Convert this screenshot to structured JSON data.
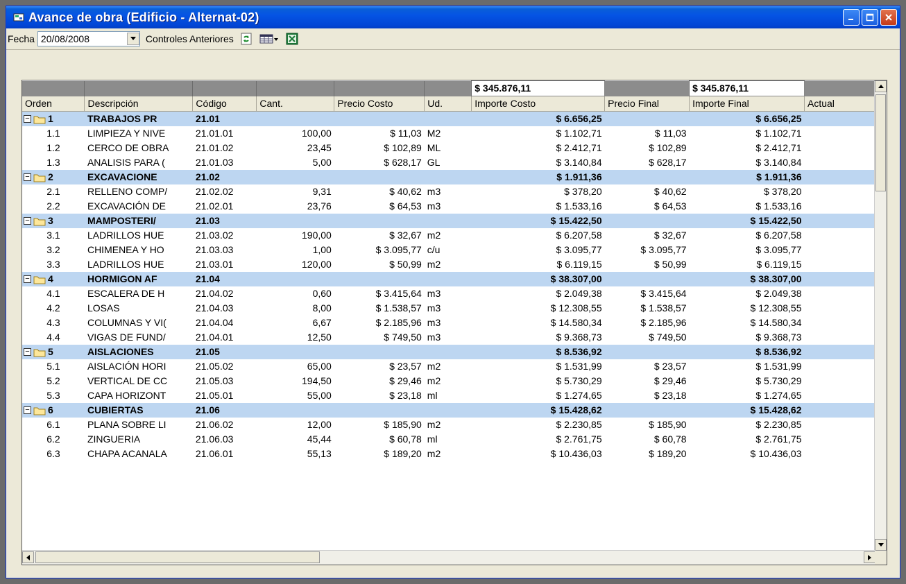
{
  "window": {
    "title": "Avance de obra (Edificio - Alternat-02)"
  },
  "toolbar": {
    "fecha_label": "Fecha",
    "fecha_value": "20/08/2008",
    "controles_label": "Controles Anteriores"
  },
  "totals": {
    "importe_costo": "$ 345.876,11",
    "importe_final": "$ 345.876,11"
  },
  "columns": [
    "Orden",
    "Descripción",
    "Código",
    "Cant.",
    "Precio Costo",
    "Ud.",
    "Importe Costo",
    "Precio Final",
    "Importe Final",
    "Actual"
  ],
  "rows": [
    {
      "type": "group",
      "orden": "1",
      "desc": "TRABAJOS PR",
      "codigo": "21.01",
      "importe_costo": "$ 6.656,25",
      "importe_final": "$ 6.656,25"
    },
    {
      "type": "item",
      "orden": "1.1",
      "desc": "LIMPIEZA Y NIVE",
      "codigo": "21.01.01",
      "cant": "100,00",
      "precio_costo": "$ 11,03",
      "ud": "M2",
      "importe_costo": "$ 1.102,71",
      "precio_final": "$ 11,03",
      "importe_final": "$ 1.102,71"
    },
    {
      "type": "item",
      "orden": "1.2",
      "desc": "CERCO DE OBRA",
      "codigo": "21.01.02",
      "cant": "23,45",
      "precio_costo": "$ 102,89",
      "ud": "ML",
      "importe_costo": "$ 2.412,71",
      "precio_final": "$ 102,89",
      "importe_final": "$ 2.412,71"
    },
    {
      "type": "item",
      "orden": "1.3",
      "desc": "ANALISIS PARA (",
      "codigo": "21.01.03",
      "cant": "5,00",
      "precio_costo": "$ 628,17",
      "ud": "GL",
      "importe_costo": "$ 3.140,84",
      "precio_final": "$ 628,17",
      "importe_final": "$ 3.140,84"
    },
    {
      "type": "group",
      "orden": "2",
      "desc": "EXCAVACIONE",
      "codigo": "21.02",
      "importe_costo": "$ 1.911,36",
      "importe_final": "$ 1.911,36"
    },
    {
      "type": "item",
      "orden": "2.1",
      "desc": "RELLENO COMP/",
      "codigo": "21.02.02",
      "cant": "9,31",
      "precio_costo": "$ 40,62",
      "ud": "m3",
      "importe_costo": "$ 378,20",
      "precio_final": "$ 40,62",
      "importe_final": "$ 378,20"
    },
    {
      "type": "item",
      "orden": "2.2",
      "desc": "EXCAVACIÓN DE",
      "codigo": "21.02.01",
      "cant": "23,76",
      "precio_costo": "$ 64,53",
      "ud": "m3",
      "importe_costo": "$ 1.533,16",
      "precio_final": "$ 64,53",
      "importe_final": "$ 1.533,16"
    },
    {
      "type": "group",
      "orden": "3",
      "desc": "MAMPOSTERI/",
      "codigo": "21.03",
      "importe_costo": "$ 15.422,50",
      "importe_final": "$ 15.422,50"
    },
    {
      "type": "item",
      "orden": "3.1",
      "desc": "LADRILLOS HUE",
      "codigo": "21.03.02",
      "cant": "190,00",
      "precio_costo": "$ 32,67",
      "ud": "m2",
      "importe_costo": "$ 6.207,58",
      "precio_final": "$ 32,67",
      "importe_final": "$ 6.207,58"
    },
    {
      "type": "item",
      "orden": "3.2",
      "desc": "CHIMENEA Y HO",
      "codigo": "21.03.03",
      "cant": "1,00",
      "precio_costo": "$ 3.095,77",
      "ud": "c/u",
      "importe_costo": "$ 3.095,77",
      "precio_final": "$ 3.095,77",
      "importe_final": "$ 3.095,77"
    },
    {
      "type": "item",
      "orden": "3.3",
      "desc": "LADRILLOS HUE",
      "codigo": "21.03.01",
      "cant": "120,00",
      "precio_costo": "$ 50,99",
      "ud": "m2",
      "importe_costo": "$ 6.119,15",
      "precio_final": "$ 50,99",
      "importe_final": "$ 6.119,15"
    },
    {
      "type": "group",
      "orden": "4",
      "desc": "HORMIGON AF",
      "codigo": "21.04",
      "importe_costo": "$ 38.307,00",
      "importe_final": "$ 38.307,00"
    },
    {
      "type": "item",
      "orden": "4.1",
      "desc": "ESCALERA DE H",
      "codigo": "21.04.02",
      "cant": "0,60",
      "precio_costo": "$ 3.415,64",
      "ud": "m3",
      "importe_costo": "$ 2.049,38",
      "precio_final": "$ 3.415,64",
      "importe_final": "$ 2.049,38"
    },
    {
      "type": "item",
      "orden": "4.2",
      "desc": "LOSAS",
      "codigo": "21.04.03",
      "cant": "8,00",
      "precio_costo": "$ 1.538,57",
      "ud": "m3",
      "importe_costo": "$ 12.308,55",
      "precio_final": "$ 1.538,57",
      "importe_final": "$ 12.308,55"
    },
    {
      "type": "item",
      "orden": "4.3",
      "desc": "COLUMNAS Y VI(",
      "codigo": "21.04.04",
      "cant": "6,67",
      "precio_costo": "$ 2.185,96",
      "ud": "m3",
      "importe_costo": "$ 14.580,34",
      "precio_final": "$ 2.185,96",
      "importe_final": "$ 14.580,34"
    },
    {
      "type": "item",
      "orden": "4.4",
      "desc": "VIGAS DE FUND/",
      "codigo": "21.04.01",
      "cant": "12,50",
      "precio_costo": "$ 749,50",
      "ud": "m3",
      "importe_costo": "$ 9.368,73",
      "precio_final": "$ 749,50",
      "importe_final": "$ 9.368,73"
    },
    {
      "type": "group",
      "orden": "5",
      "desc": "AISLACIONES",
      "codigo": "21.05",
      "importe_costo": "$ 8.536,92",
      "importe_final": "$ 8.536,92"
    },
    {
      "type": "item",
      "orden": "5.1",
      "desc": "AISLACIÓN HORI",
      "codigo": "21.05.02",
      "cant": "65,00",
      "precio_costo": "$ 23,57",
      "ud": "m2",
      "importe_costo": "$ 1.531,99",
      "precio_final": "$ 23,57",
      "importe_final": "$ 1.531,99"
    },
    {
      "type": "item",
      "orden": "5.2",
      "desc": "VERTICAL DE CC",
      "codigo": "21.05.03",
      "cant": "194,50",
      "precio_costo": "$ 29,46",
      "ud": "m2",
      "importe_costo": "$ 5.730,29",
      "precio_final": "$ 29,46",
      "importe_final": "$ 5.730,29"
    },
    {
      "type": "item",
      "orden": "5.3",
      "desc": "CAPA HORIZONT",
      "codigo": "21.05.01",
      "cant": "55,00",
      "precio_costo": "$ 23,18",
      "ud": "ml",
      "importe_costo": "$ 1.274,65",
      "precio_final": "$ 23,18",
      "importe_final": "$ 1.274,65"
    },
    {
      "type": "group",
      "orden": "6",
      "desc": "CUBIERTAS",
      "codigo": "21.06",
      "importe_costo": "$ 15.428,62",
      "importe_final": "$ 15.428,62"
    },
    {
      "type": "item",
      "orden": "6.1",
      "desc": "PLANA SOBRE LI",
      "codigo": "21.06.02",
      "cant": "12,00",
      "precio_costo": "$ 185,90",
      "ud": "m2",
      "importe_costo": "$ 2.230,85",
      "precio_final": "$ 185,90",
      "importe_final": "$ 2.230,85"
    },
    {
      "type": "item",
      "orden": "6.2",
      "desc": "ZINGUERIA",
      "codigo": "21.06.03",
      "cant": "45,44",
      "precio_costo": "$ 60,78",
      "ud": "ml",
      "importe_costo": "$ 2.761,75",
      "precio_final": "$ 60,78",
      "importe_final": "$ 2.761,75"
    },
    {
      "type": "item",
      "orden": "6.3",
      "desc": "CHAPA ACANALA",
      "codigo": "21.06.01",
      "cant": "55,13",
      "precio_costo": "$ 189,20",
      "ud": "m2",
      "importe_costo": "$ 10.436,03",
      "precio_final": "$ 189,20",
      "importe_final": "$ 10.436,03"
    }
  ]
}
